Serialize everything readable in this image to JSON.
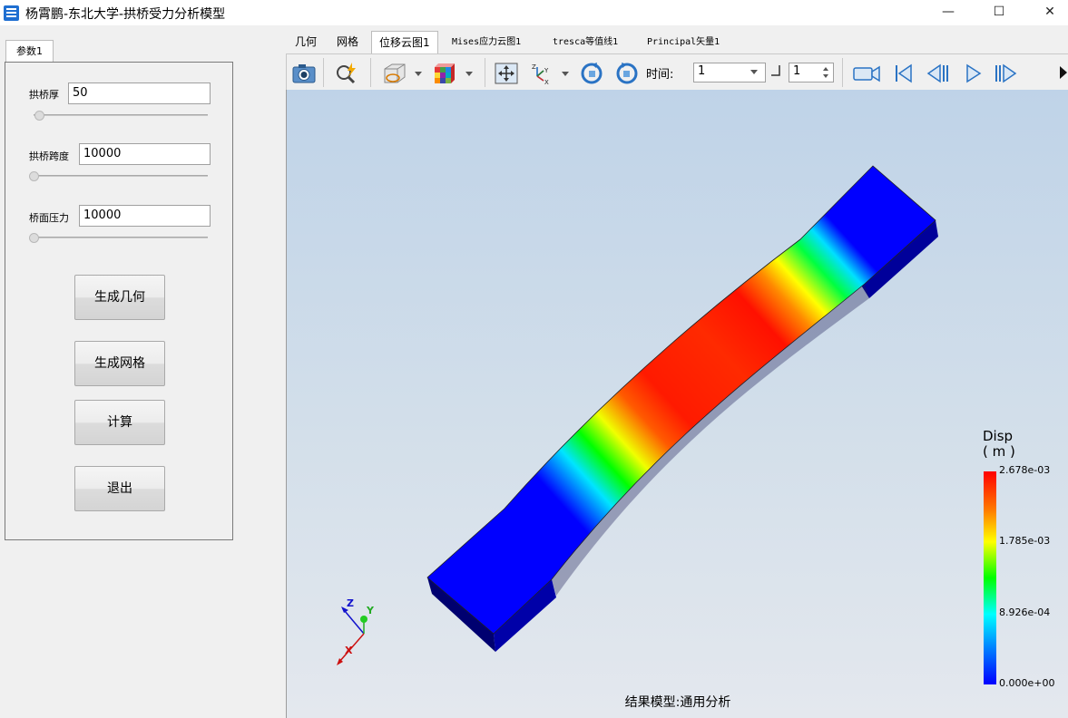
{
  "window": {
    "title": "杨霄鹏-东北大学-拱桥受力分析模型",
    "minimize": "—",
    "maximize": "☐",
    "close": "✕"
  },
  "left_panel": {
    "tab": "参数1",
    "params": [
      {
        "label": "拱桥厚",
        "value": "50",
        "slider_fraction": 0.03
      },
      {
        "label": "拱桥跨度",
        "value": "10000",
        "slider_fraction": 0.0
      },
      {
        "label": "桥面压力",
        "value": "10000",
        "slider_fraction": 0.0
      }
    ],
    "buttons": [
      "生成几何",
      "生成网格",
      "计算",
      "退出"
    ]
  },
  "tabs": [
    "几何",
    "网格",
    "位移云图1",
    "Mises应力云图1",
    "tresca等值线1",
    "Principal矢量1"
  ],
  "active_tab": "位移云图1",
  "toolbar": {
    "icons": [
      "camera-icon",
      "zoom-icon",
      "display-mode-icon",
      "colormap-icon",
      "fit-view-icon",
      "axes-icon",
      "rotate-left-icon",
      "rotate-right-icon",
      "record-icon",
      "first-frame-icon",
      "prev-frame-icon",
      "play-icon",
      "next-frame-icon"
    ],
    "time_label": "时间:",
    "time_value": "1",
    "frame_value": "1"
  },
  "viewport": {
    "caption": "结果模型:通用分析",
    "legend": {
      "title_line1": "Disp",
      "title_line2": "( m )",
      "values": [
        "2.678e-03",
        "1.785e-03",
        "8.926e-04",
        "0.000e+00"
      ]
    },
    "axes": {
      "z": "Z",
      "y": "Y",
      "x": "X"
    },
    "colors": {
      "high": "#ff0000",
      "mid": "#00ff00",
      "low": "#0000ff"
    }
  }
}
